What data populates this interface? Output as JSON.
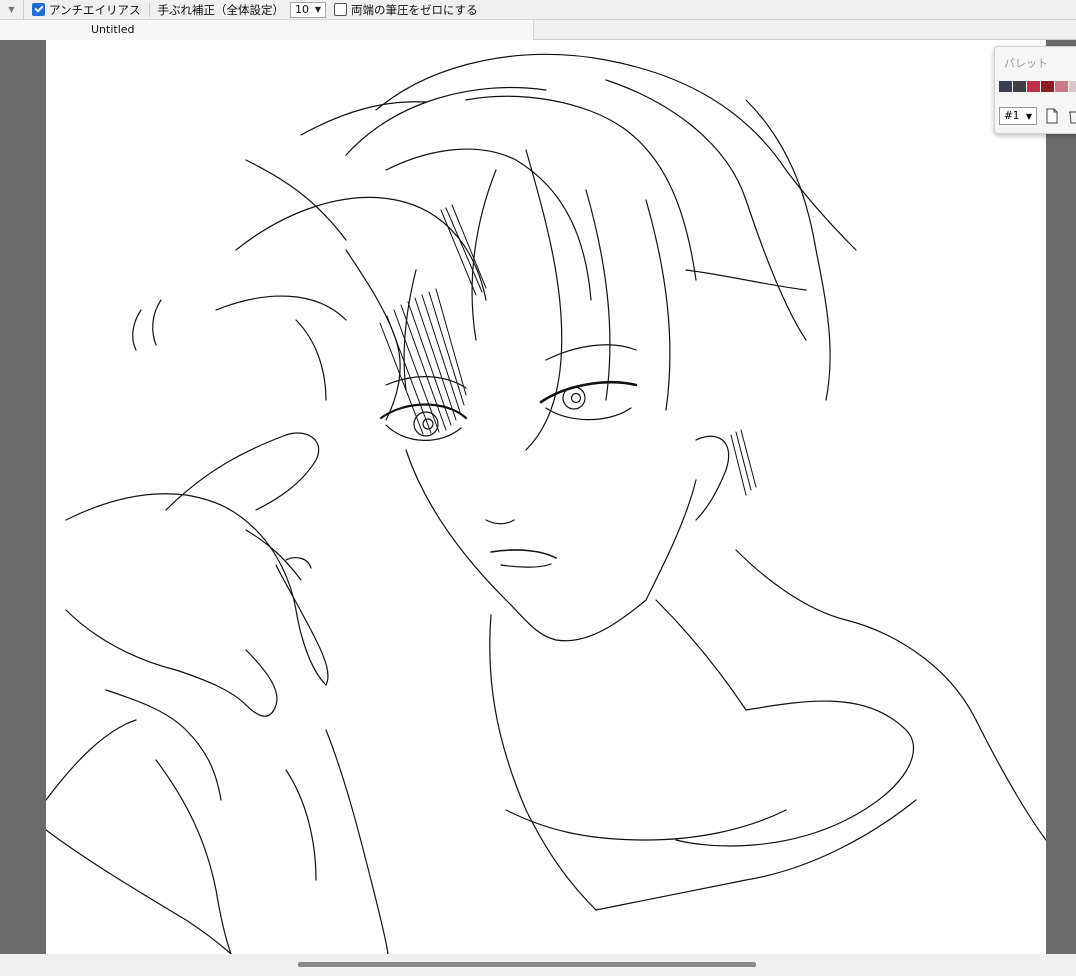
{
  "toolbar": {
    "antialias_label": "アンチエイリアス",
    "antialias_checked": true,
    "stabilizer_label": "手ぶれ補正（全体設定）",
    "stabilizer_value": "10",
    "zero_pressure_label": "両端の筆圧をゼロにする",
    "zero_pressure_checked": false
  },
  "tabs": [
    {
      "label": "Untitled"
    }
  ],
  "palette": {
    "title": "パレット",
    "swatches": [
      "#3a3f52",
      "#3f3f45",
      "#c0304a",
      "#8a1c24",
      "#c97a88",
      "#d8c8cc"
    ],
    "selected": "#1"
  },
  "colors": {
    "workspace": "#6b6b6b",
    "canvas": "#ffffff",
    "accent": "#1f6fd1"
  }
}
